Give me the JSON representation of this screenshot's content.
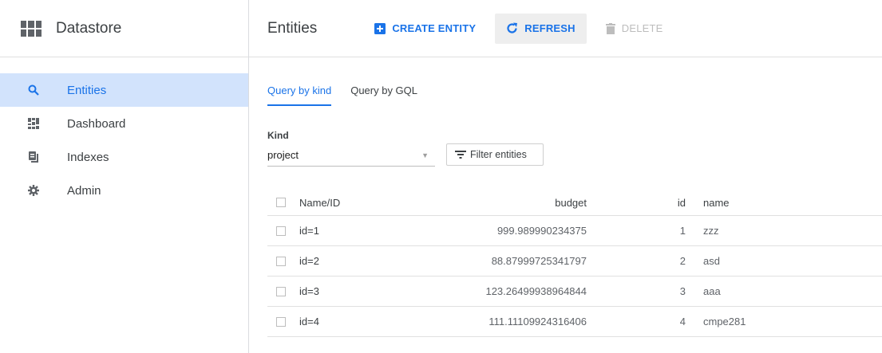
{
  "sidebar": {
    "title": "Datastore",
    "items": [
      {
        "label": "Entities",
        "icon": "search-icon",
        "active": true
      },
      {
        "label": "Dashboard",
        "icon": "dashboard-icon",
        "active": false
      },
      {
        "label": "Indexes",
        "icon": "indexes-icon",
        "active": false
      },
      {
        "label": "Admin",
        "icon": "gear-icon",
        "active": false
      }
    ]
  },
  "toolbar": {
    "title": "Entities",
    "create_label": "CREATE ENTITY",
    "refresh_label": "REFRESH",
    "delete_label": "DELETE"
  },
  "tabs": [
    {
      "label": "Query by kind",
      "active": true
    },
    {
      "label": "Query by GQL",
      "active": false
    }
  ],
  "kind": {
    "label": "Kind",
    "value": "project"
  },
  "filter_label": "Filter entities",
  "table": {
    "headers": {
      "name": "Name/ID",
      "budget": "budget",
      "id": "id",
      "nm": "name"
    },
    "rows": [
      {
        "name": "id=1",
        "budget": "999.989990234375",
        "id": "1",
        "nm": "zzz"
      },
      {
        "name": "id=2",
        "budget": "88.87999725341797",
        "id": "2",
        "nm": "asd"
      },
      {
        "name": "id=3",
        "budget": "123.26499938964844",
        "id": "3",
        "nm": "aaa"
      },
      {
        "name": "id=4",
        "budget": "111.11109924316406",
        "id": "4",
        "nm": "cmpe281"
      }
    ]
  },
  "colors": {
    "accent": "#1a73e8",
    "active_bg": "#d2e3fc",
    "disabled": "#bdbdbd"
  }
}
